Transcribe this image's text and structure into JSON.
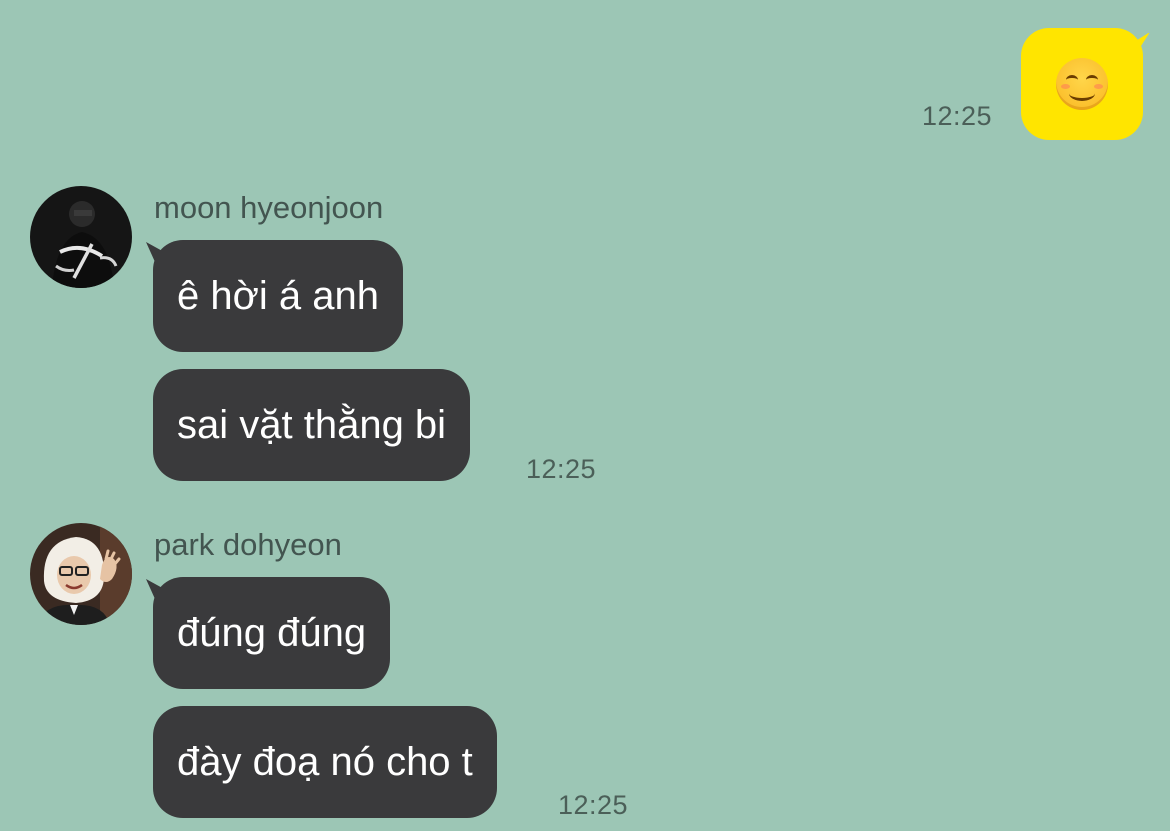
{
  "conversation": {
    "outgoing": {
      "emoji": "😊",
      "emoji_name": "smiling-face-with-smiling-eyes",
      "time": "12:25",
      "bubble_color": "#ffe500"
    },
    "groups": [
      {
        "sender": "moon hyeonjoon",
        "avatar": "avatar-dark-jacket",
        "messages": [
          "ê hời á anh",
          "sai vặt thằng bi"
        ],
        "time": "12:25"
      },
      {
        "sender": "park dohyeon",
        "avatar": "avatar-fluffy-hood",
        "messages": [
          "đúng đúng",
          "đày đoạ nó cho t"
        ],
        "time": "12:25"
      }
    ]
  },
  "colors": {
    "background": "#9cc6b5",
    "incoming_bubble": "#3a3a3c",
    "incoming_text": "#ffffff",
    "timestamp": "#4b5f58"
  }
}
